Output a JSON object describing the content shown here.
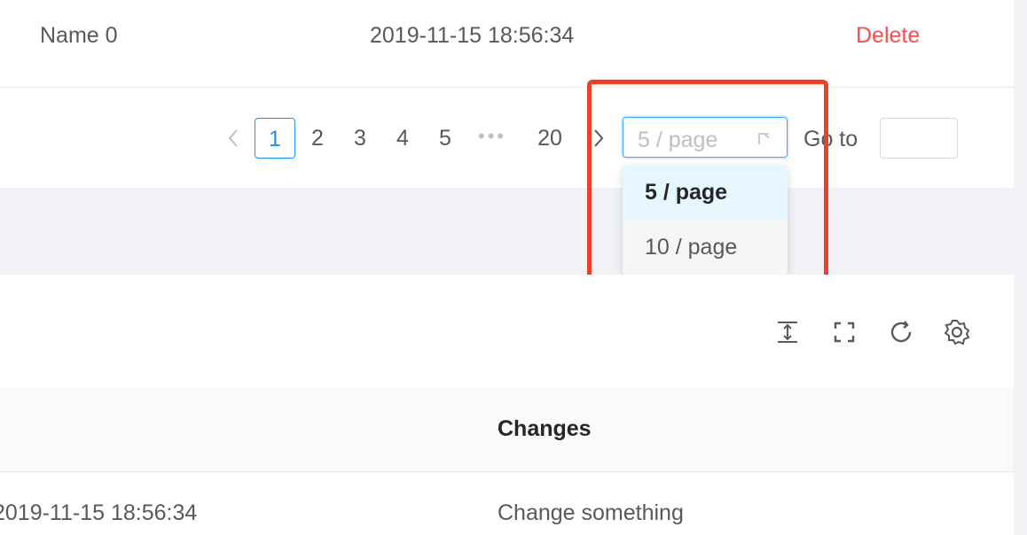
{
  "table_top": {
    "row": {
      "name": "Name 0",
      "time": "2019-11-15 18:56:34",
      "action": "Delete"
    }
  },
  "pagination": {
    "pages": [
      "1",
      "2",
      "3",
      "4",
      "5"
    ],
    "ellipsis": "•••",
    "last_page": "20",
    "current_page": "1",
    "page_size": {
      "value": "5 / page",
      "options": [
        "5 / page",
        "10 / page"
      ]
    },
    "goto_label": "Go to",
    "goto_value": ""
  },
  "toolbar": {
    "icons": [
      "column-height-icon",
      "fullscreen-icon",
      "reload-icon",
      "settings-icon"
    ]
  },
  "table_bottom": {
    "header": {
      "changes": "Changes"
    },
    "row": {
      "time": "2019-11-15 18:56:34",
      "changes": "Change something"
    }
  },
  "colors": {
    "primary": "#1890ff",
    "danger": "#ff4d4f",
    "highlight": "#e8412c"
  }
}
